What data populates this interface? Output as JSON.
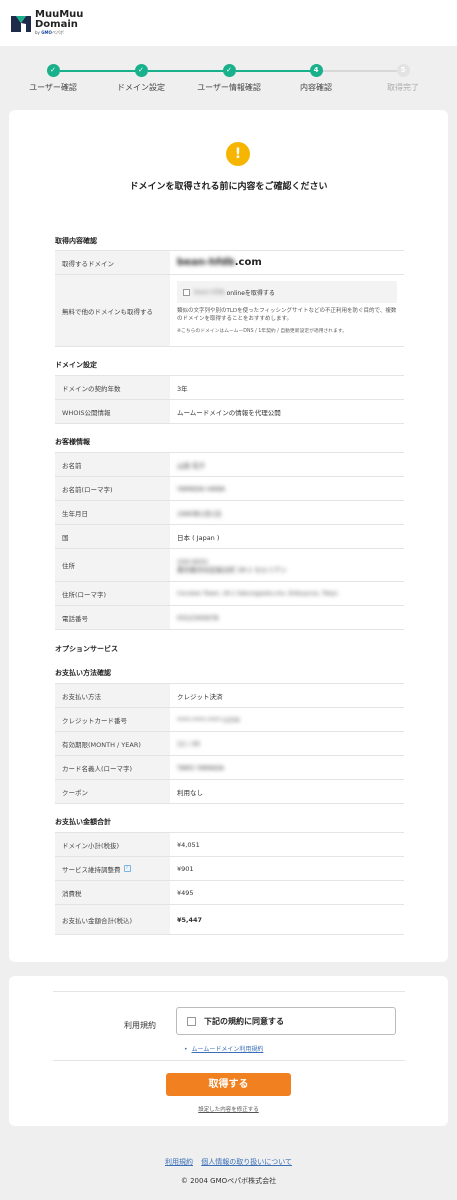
{
  "logo": {
    "line1": "MuuMuu",
    "line2": "Domain",
    "line3_prefix": "by ",
    "line3_brand": "GMO",
    "line3_suffix": "ペパボ"
  },
  "steps": [
    {
      "num": "1",
      "label": "ユーザー確認",
      "done": true
    },
    {
      "num": "2",
      "label": "ドメイン設定",
      "done": true
    },
    {
      "num": "3",
      "label": "ユーザー情報確認",
      "done": true
    },
    {
      "num": "4",
      "label": "内容確認",
      "done": true
    },
    {
      "num": "5",
      "label": "取得完了",
      "done": false
    }
  ],
  "colors": {
    "accent": "#19b08c",
    "warning": "#f6b500",
    "button": "#f08020",
    "link": "#3a6fb8"
  },
  "main": {
    "warning_glyph": "!",
    "title": "ドメインを取得される前に内容をご確認ください",
    "sections": {
      "acquisition": {
        "title": "取得内容確認",
        "domain_label": "取得するドメイン",
        "domain_name_blurred": "bean-hfdb",
        "domain_tld": ".com",
        "other_label": "無料で他のドメインも取得する",
        "other_option_blurred": "bean-hfdb.",
        "other_option_text": "onlineを取得する",
        "other_note": "類似の文字列や別のTLDを使ったフィッシングサイトなどの不正利用を防ぐ目的で、複数のドメインを取得することをおすすめします。",
        "other_note_small": "※こちらのドメインはムームーDNS / 1年契約 / 自動更新設定が適用されます。"
      },
      "domain_settings": {
        "title": "ドメイン設定",
        "rows": [
          {
            "label": "ドメインの契約年数",
            "value": "3年"
          },
          {
            "label": "WHOIS公開情報",
            "value": "ムームードメインの情報を代理公開"
          }
        ]
      },
      "customer": {
        "title": "お客様情報",
        "rows": [
          {
            "label": "お名前",
            "value": "山田 花子"
          },
          {
            "label": "お名前(ローマ字)",
            "value": "YAMADA HANA"
          },
          {
            "label": "生年月日",
            "value": "1990年1月1日"
          },
          {
            "label": "国",
            "value": "日本 ( Japan )"
          },
          {
            "label": "住所",
            "value1": "150-0031",
            "value2": "東京都渋谷区桜丘町 26-1 セルリアン"
          },
          {
            "label": "住所(ローマ字)",
            "value": "Cerulean Tower, 26-1 Sakuragaoka-cho, Shibuya-ku, Tokyo"
          },
          {
            "label": "電話番号",
            "value": "0312345678"
          }
        ]
      },
      "options": {
        "title": "オプションサービス"
      },
      "payment": {
        "title": "お支払い方法確認",
        "rows": [
          {
            "label": "お支払い方法",
            "value": "クレジット決済"
          },
          {
            "label": "クレジットカード番号",
            "value": "****-****-****-1234"
          },
          {
            "label": "有効期限(MONTH / YEAR)",
            "value": "12 / 30"
          },
          {
            "label": "カード名義人(ローマ字)",
            "value": "TARO YAMADA"
          },
          {
            "label": "クーポン",
            "value": "利用なし"
          }
        ]
      },
      "totals": {
        "title": "お支払い金額合計",
        "rows": [
          {
            "label": "ドメイン小計(税抜)",
            "value": "¥4,051"
          },
          {
            "label": "サービス維持調整費",
            "value": "¥901"
          },
          {
            "label": "消費税",
            "value": "¥495"
          },
          {
            "label": "お支払い金額合計(税込)",
            "value": "¥5,447"
          }
        ]
      }
    }
  },
  "terms": {
    "label": "利用規約",
    "agree_text": "下記の規約に同意する",
    "link_text": "ムームードメイン利用規約",
    "submit_label": "取得する",
    "edit_link": "設定した内容を修正する"
  },
  "footer": {
    "link1": "利用規約",
    "link2": "個人情報の取り扱いについて",
    "copyright": "© 2004 GMOペパボ株式会社"
  }
}
